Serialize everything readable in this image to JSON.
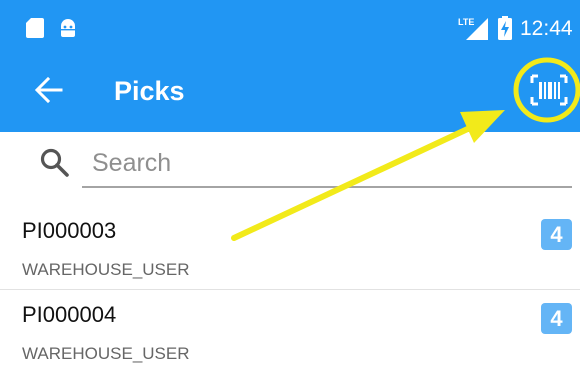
{
  "status_bar": {
    "time": "12:44",
    "network_label": "LTE",
    "icons": [
      "sd-card-icon",
      "android-icon",
      "lte-signal-icon",
      "battery-charging-icon"
    ]
  },
  "app_bar": {
    "title": "Picks",
    "back_icon": "arrow-left-icon",
    "action_icon": "barcode-scan-icon",
    "color": "#2196f3"
  },
  "search": {
    "placeholder": "Search",
    "value": ""
  },
  "picks": [
    {
      "id": "PI000003",
      "user": "WAREHOUSE_USER",
      "count": "4"
    },
    {
      "id": "PI000004",
      "user": "WAREHOUSE_USER",
      "count": "4"
    }
  ],
  "annotation": {
    "color": "#f2ea1a",
    "description_icon": "arrow-highlight"
  },
  "colors": {
    "badge": "#64b5f6",
    "highlight": "#f2ea1a"
  }
}
